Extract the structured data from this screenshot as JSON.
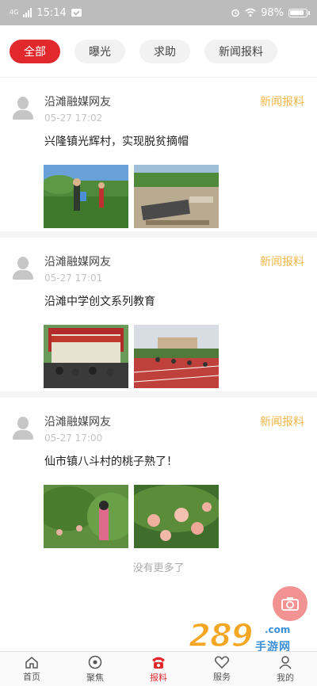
{
  "status_bar": {
    "carrier": "4G",
    "time": "15:14",
    "battery": "98%",
    "icons": [
      "signal-icon",
      "message-icon",
      "alarm-icon",
      "wifi-icon",
      "battery-icon"
    ]
  },
  "tabs": [
    {
      "label": "全部",
      "active": true
    },
    {
      "label": "曝光",
      "active": false
    },
    {
      "label": "求助",
      "active": false
    },
    {
      "label": "新闻报料",
      "active": false
    }
  ],
  "posts": [
    {
      "author": "沿滩融媒网友",
      "time": "05-27 17:02",
      "tag": "新闻报料",
      "title": "兴隆镇光辉村，实现脱贫摘帽"
    },
    {
      "author": "沿滩融媒网友",
      "time": "05-27 17:01",
      "tag": "新闻报料",
      "title": "沿滩中学创文系列教育"
    },
    {
      "author": "沿滩融媒网友",
      "time": "05-27 17:00",
      "tag": "新闻报料",
      "title": "仙市镇八斗村的桃子熟了！"
    }
  ],
  "footer_text": "没有更多了",
  "watermark": {
    "number": "289",
    "domain": ".com",
    "text": "手游网"
  },
  "bottom_nav": [
    {
      "label": "首页",
      "icon": "home-icon",
      "active": false
    },
    {
      "label": "聚焦",
      "icon": "focus-icon",
      "active": false
    },
    {
      "label": "报料",
      "icon": "phone-icon",
      "active": true
    },
    {
      "label": "服务",
      "icon": "heart-icon",
      "active": false
    },
    {
      "label": "我的",
      "icon": "user-icon",
      "active": false
    }
  ],
  "colors": {
    "accent": "#e0282d",
    "tag": "#f0b74a",
    "status_bar": "#bcbcbc"
  }
}
